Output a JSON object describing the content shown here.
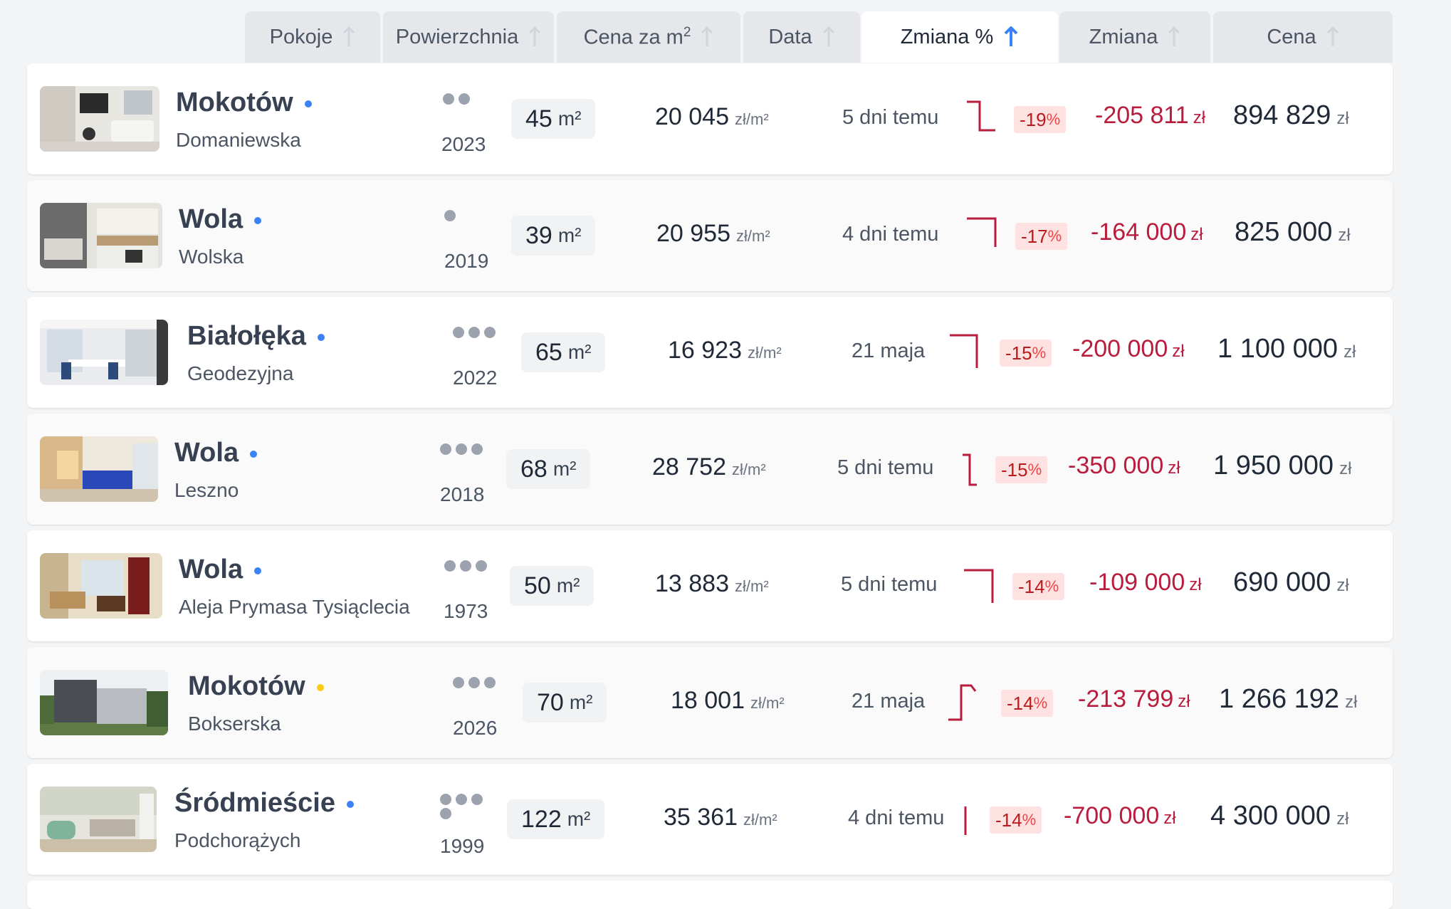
{
  "columns": [
    {
      "key": "pokoje",
      "label": "Pokoje",
      "sorted": false
    },
    {
      "key": "powierzchnia",
      "label": "Powierzchnia",
      "sorted": false
    },
    {
      "key": "cena_m2",
      "label": "Cena za m",
      "sup": "2",
      "sorted": false
    },
    {
      "key": "data",
      "label": "Data",
      "sorted": false
    },
    {
      "key": "zmiana_pct",
      "label": "Zmiana %",
      "sorted": true
    },
    {
      "key": "zmiana",
      "label": "Zmiana",
      "sorted": false
    },
    {
      "key": "cena",
      "label": "Cena",
      "sorted": false
    }
  ],
  "colors": {
    "arrow_inactive": "#d1d5db",
    "arrow_active": "#3b82f6",
    "dot_blue": "#3b82f6",
    "dot_yellow": "#facc15",
    "negative": "#b91c3c",
    "spark": "#b91c3c"
  },
  "rows": [
    {
      "district": "Mokotów",
      "street": "Domaniewska",
      "status_dot": "blue",
      "rooms": 2,
      "year": "2023",
      "area": "45",
      "area_unit": "m²",
      "price_per_m2": "20 045",
      "ppm_unit": "zł/m²",
      "date": "5 dni temu",
      "change_pct": "-19",
      "pct_sign": "%",
      "change": "-205 811",
      "change_unit": "zł",
      "price": "894 829",
      "price_unit": "zł",
      "spark": "drop",
      "thumb": "interior-white"
    },
    {
      "district": "Wola",
      "street": "Wolska",
      "status_dot": "blue",
      "rooms": 1,
      "year": "2019",
      "area": "39",
      "area_unit": "m²",
      "price_per_m2": "20 955",
      "ppm_unit": "zł/m²",
      "date": "4 dni temu",
      "change_pct": "-17",
      "pct_sign": "%",
      "change": "-164 000",
      "change_unit": "zł",
      "price": "825 000",
      "price_unit": "zł",
      "spark": "drop",
      "thumb": "interior-kitchen"
    },
    {
      "district": "Białołęka",
      "street": "Geodezyjna",
      "status_dot": "blue",
      "rooms": 3,
      "year": "2022",
      "area": "65",
      "area_unit": "m²",
      "price_per_m2": "16 923",
      "ppm_unit": "zł/m²",
      "date": "21 maja",
      "change_pct": "-15",
      "pct_sign": "%",
      "change": "-200 000",
      "change_unit": "zł",
      "price": "1 100 000",
      "price_unit": "zł",
      "spark": "drop",
      "thumb": "interior-dining"
    },
    {
      "district": "Wola",
      "street": "Leszno",
      "status_dot": "blue",
      "rooms": 3,
      "year": "2018",
      "area": "68",
      "area_unit": "m²",
      "price_per_m2": "28 752",
      "ppm_unit": "zł/m²",
      "date": "5 dni temu",
      "change_pct": "-15",
      "pct_sign": "%",
      "change": "-350 000",
      "change_unit": "zł",
      "price": "1 950 000",
      "price_unit": "zł",
      "spark": "drop-short",
      "thumb": "interior-blue"
    },
    {
      "district": "Wola",
      "street": "Aleja Prymasa Tysiąclecia",
      "status_dot": "blue",
      "rooms": 3,
      "year": "1973",
      "area": "50",
      "area_unit": "m²",
      "price_per_m2": "13 883",
      "ppm_unit": "zł/m²",
      "date": "5 dni temu",
      "change_pct": "-14",
      "pct_sign": "%",
      "change": "-109 000",
      "change_unit": "zł",
      "price": "690 000",
      "price_unit": "zł",
      "spark": "drop",
      "thumb": "interior-warm"
    },
    {
      "district": "Mokotów",
      "street": "Bokserska",
      "status_dot": "yellow",
      "rooms": 3,
      "year": "2026",
      "area": "70",
      "area_unit": "m²",
      "price_per_m2": "18 001",
      "ppm_unit": "zł/m²",
      "date": "21 maja",
      "change_pct": "-14",
      "pct_sign": "%",
      "change": "-213 799",
      "change_unit": "zł",
      "price": "1 266 192",
      "price_unit": "zł",
      "spark": "rise",
      "thumb": "building"
    },
    {
      "district": "Śródmieście",
      "street": "Podchorążych",
      "status_dot": "blue",
      "rooms": 4,
      "year": "1999",
      "area": "122",
      "area_unit": "m²",
      "price_per_m2": "35 361",
      "ppm_unit": "zł/m²",
      "date": "4 dni temu",
      "change_pct": "-14",
      "pct_sign": "%",
      "change": "-700 000",
      "change_unit": "zł",
      "price": "4 300 000",
      "price_unit": "zł",
      "spark": "flat",
      "thumb": "interior-green"
    }
  ]
}
